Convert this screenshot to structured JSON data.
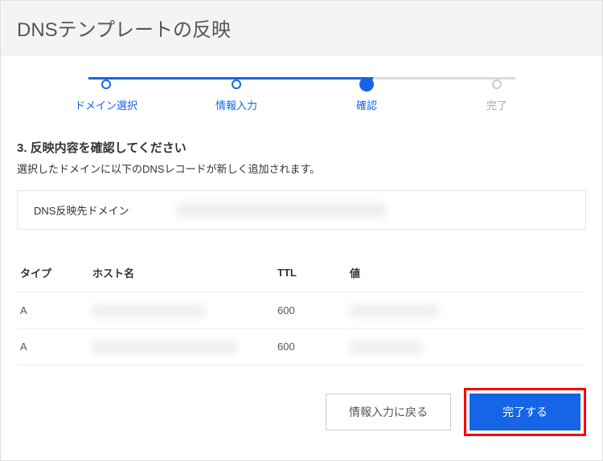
{
  "header": {
    "title": "DNSテンプレートの反映"
  },
  "steps": [
    {
      "label": "ドメイン選択",
      "state": "done"
    },
    {
      "label": "情報入力",
      "state": "done"
    },
    {
      "label": "確認",
      "state": "active"
    },
    {
      "label": "完了",
      "state": "pending"
    }
  ],
  "section": {
    "title": "3. 反映内容を確認してください",
    "desc": "選択したドメインに以下のDNSレコードが新しく追加されます。"
  },
  "domain_box": {
    "label": "DNS反映先ドメイン",
    "value": ""
  },
  "table": {
    "headers": {
      "type": "タイプ",
      "host": "ホスト名",
      "ttl": "TTL",
      "value": "値"
    },
    "rows": [
      {
        "type": "A",
        "host": "",
        "ttl": "600",
        "value": ""
      },
      {
        "type": "A",
        "host": "",
        "ttl": "600",
        "value": ""
      }
    ]
  },
  "actions": {
    "back": "情報入力に戻る",
    "complete": "完了する"
  }
}
